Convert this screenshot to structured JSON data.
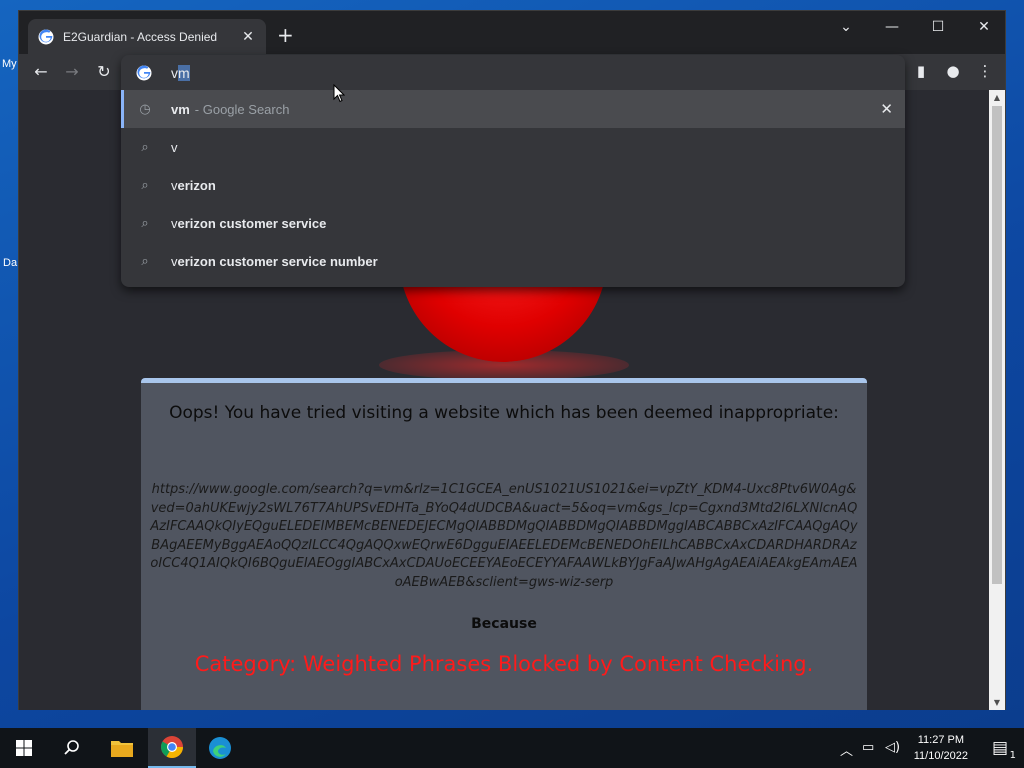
{
  "desktop": {
    "label_1": "My",
    "label_2": "Da"
  },
  "browser": {
    "tab_title": "E2Guardian - Access Denied",
    "tab_close": "✕",
    "new_tab": "+",
    "window_controls": {
      "tab_search": "⌄",
      "minimize": "—",
      "maximize": "☐",
      "close": "✕"
    },
    "nav": {
      "back": "←",
      "forward": "→",
      "reload": "↻"
    },
    "omnibox": {
      "selected_prefix": "v",
      "selected_text": "m"
    },
    "suggestions": [
      {
        "icon": "history-icon",
        "bold": "vm",
        "rest": "",
        "sub": "- Google Search",
        "active": true
      },
      {
        "icon": "search-icon",
        "bold": "",
        "rest": "v",
        "sub": "",
        "active": false
      },
      {
        "icon": "search-icon",
        "bold": "erizon",
        "rest": "v",
        "sub": "",
        "active": false
      },
      {
        "icon": "search-icon",
        "bold": "erizon customer service",
        "rest": "v",
        "sub": "",
        "active": false
      },
      {
        "icon": "search-icon",
        "bold": "erizon customer service number",
        "rest": "v",
        "sub": "",
        "active": false
      }
    ],
    "remove_suggestion": "✕"
  },
  "page": {
    "heading": "Oops! You have tried visiting a website which has been deemed inappropriate:",
    "blocked_url": "https://www.google.com/search?q=vm&rlz=1C1GCEA_enUS1021US1021&ei=vpZtY_KDM4-Uxc8Ptv6W0Ag&ved=0ahUKEwjy2sWL76T7AhUPSvEDHTa_BYoQ4dUDCBA&uact=5&oq=vm&gs_lcp=Cgxnd3Mtd2l6LXNlcnAQAzIFCAAQkQIyEQguELEDEIMBEMcBENEDEJECMgQIABBDMgQIABBDMgQIABBDMggIABCABBCxAzIFCAAQgAQyBAgAEEMyBggAEAoQQzILCC4QgAQQxwEQrwE6DgguEIAEELEDEMcBENEDOhEILhCABBCxAxCDARDHARDRAzoICC4Q1AIQkQI6BQguEIAEOggIABCxAxCDAUoECEEYAEoECEYYAFAAWLkBYJgFaAJwAHgAgAEAiAEAkgEAmAEAoAEBwAEB&sclient=gws-wiz-serp",
    "because": "Because",
    "category": "Category: Weighted Phrases  Blocked by Content Checking."
  },
  "taskbar": {
    "clock_time": "11:27 PM",
    "clock_date": "11/10/2022",
    "notification_count": "1"
  }
}
